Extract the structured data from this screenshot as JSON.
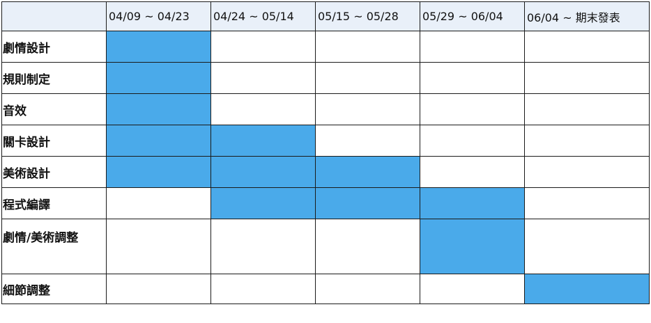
{
  "colors": {
    "header_bg": "#e9f0f9",
    "active": "#4aaaea",
    "border": "#1a1a1a"
  },
  "header": {
    "periods": [
      "04/09 ~ 04/23",
      "04/24 ~ 05/14",
      "05/15 ~ 05/28",
      "05/29 ~ 06/04",
      "06/04 ~ 期末發表"
    ]
  },
  "tasks": [
    {
      "label": "劇情設計",
      "active": [
        true,
        false,
        false,
        false,
        false
      ]
    },
    {
      "label": "規則制定",
      "active": [
        true,
        false,
        false,
        false,
        false
      ]
    },
    {
      "label": "音效",
      "active": [
        true,
        false,
        false,
        false,
        false
      ]
    },
    {
      "label": "關卡設計",
      "active": [
        true,
        true,
        false,
        false,
        false
      ]
    },
    {
      "label": "美術設計",
      "active": [
        true,
        true,
        true,
        false,
        false
      ]
    },
    {
      "label": "程式編譯",
      "active": [
        false,
        true,
        true,
        true,
        false
      ]
    },
    {
      "label": "劇情/美術調整",
      "active": [
        false,
        false,
        false,
        true,
        false
      ]
    },
    {
      "label": "細節調整",
      "active": [
        false,
        false,
        false,
        false,
        true
      ]
    }
  ]
}
